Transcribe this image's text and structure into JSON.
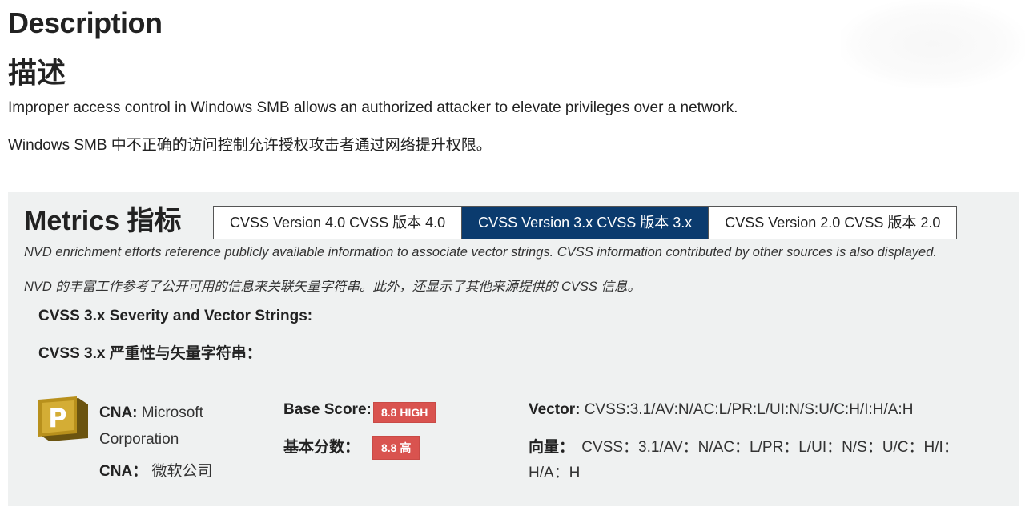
{
  "description": {
    "title": "Description",
    "title_zh": "描述",
    "text_en": "Improper access control in Windows SMB allows an authorized attacker to elevate privileges over a network.",
    "text_zh": "Windows SMB 中不正确的访问控制允许授权攻击者通过网络提升权限。"
  },
  "metrics": {
    "title": "Metrics 指标",
    "tabs": [
      {
        "label": "CVSS Version 4.0 CVSS 版本 4.0",
        "active": false
      },
      {
        "label": "CVSS Version 3.x CVSS 版本 3.x",
        "active": true
      },
      {
        "label": "CVSS Version 2.0 CVSS 版本 2.0",
        "active": false
      }
    ],
    "note_en": "NVD enrichment efforts reference publicly available information to associate vector strings. CVSS information contributed by other sources is also displayed.",
    "note_zh": "NVD 的丰富工作参考了公开可用的信息来关联矢量字符串。此外，还显示了其他来源提供的 CVSS 信息。",
    "severity_heading_en": "CVSS 3.x Severity and Vector Strings:",
    "severity_heading_zh": "CVSS 3.x 严重性与矢量字符串：",
    "cna": {
      "label": "CNA:",
      "name_line1": "Microsoft",
      "name_line2": "Corporation",
      "label_zh": "CNA：",
      "name_zh": "微软公司",
      "logo_letter": "P",
      "logo_color": "#b8901c"
    },
    "score": {
      "label": "Base Score:",
      "badge": "8.8 HIGH",
      "label_zh": "基本分数：",
      "badge_zh": "8.8 高",
      "badge_color": "#d9534f"
    },
    "vector": {
      "label": "Vector:",
      "value": "CVSS:3.1/AV:N/AC:L/PR:L/UI:N/S:U/C:H/I:H/A:H",
      "label_zh": "向量：",
      "value_zh": "CVSS：3.1/AV：N/AC：L/PR：L/UI：N/S：U/C：H/I：H/A：H"
    }
  },
  "colors": {
    "active_tab": "#0b3b6e",
    "panel_bg": "#eff1f1",
    "severity_high": "#d9534f"
  }
}
